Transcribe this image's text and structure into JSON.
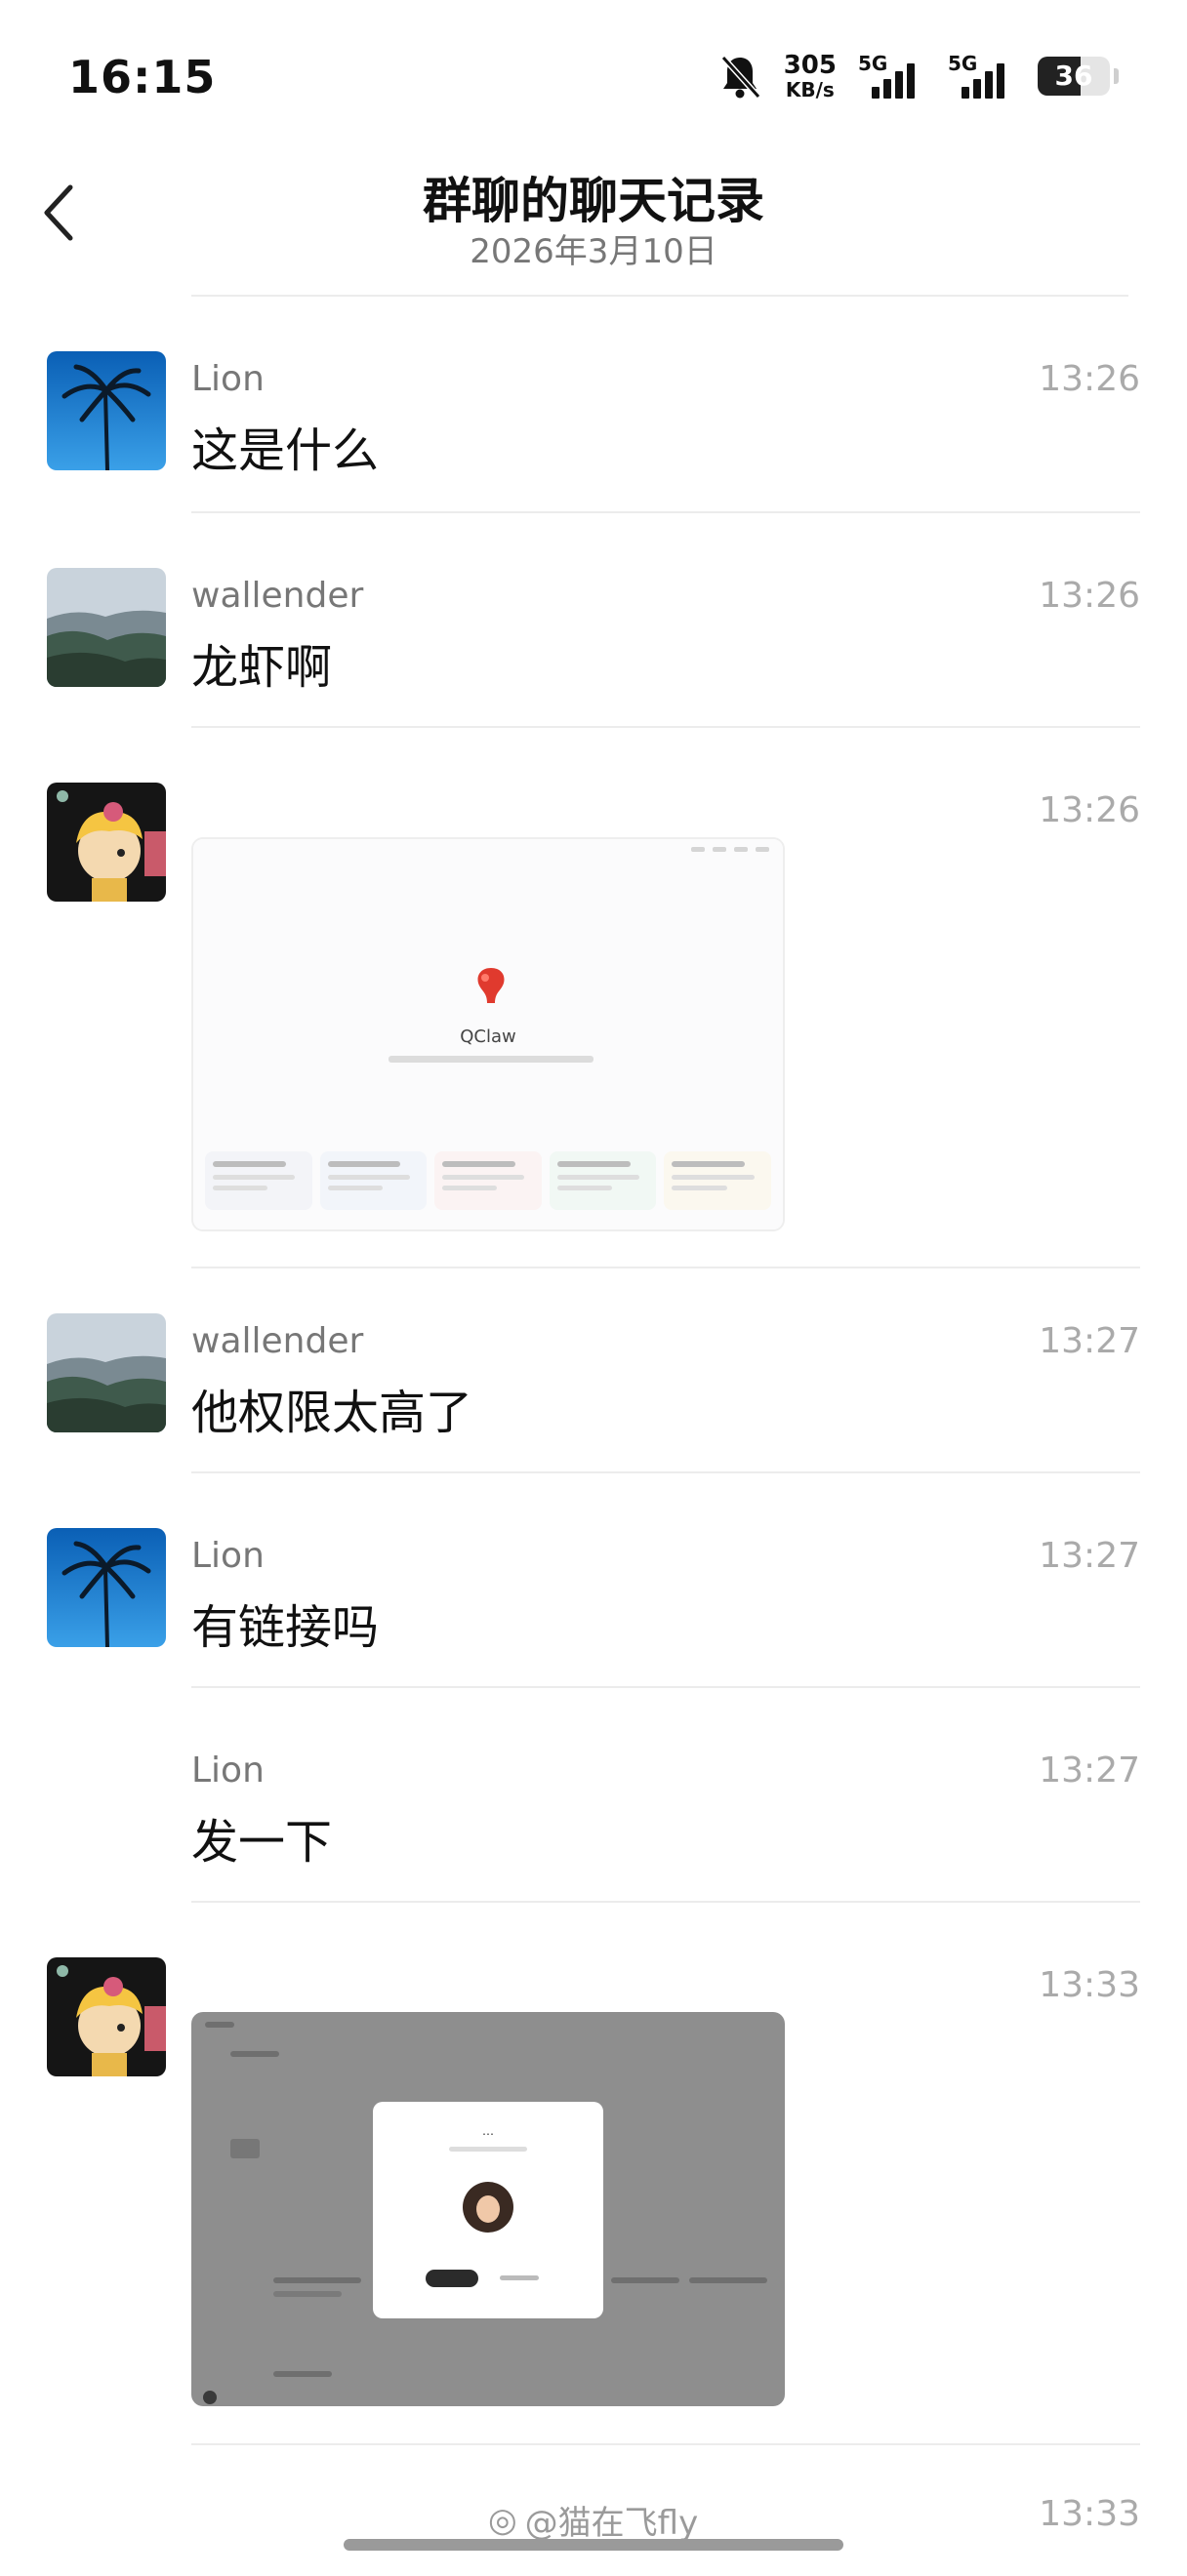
{
  "status_bar": {
    "time": "16:15",
    "net_speed_value": "305",
    "net_speed_unit": "KB/s",
    "signal1_label": "5G",
    "signal2_label": "5G",
    "battery_level": "36"
  },
  "header": {
    "title": "群聊的聊天记录",
    "date": "2026年3月10日"
  },
  "messages": [
    {
      "sender": "Lion",
      "time": "13:26",
      "text": "这是什么",
      "avatar": "palm-tree"
    },
    {
      "sender": "wallender",
      "time": "13:26",
      "text": "龙虾啊",
      "avatar": "mountain"
    },
    {
      "sender": "",
      "time": "13:26",
      "type": "image",
      "image_caption": "QClaw",
      "avatar": "cartoon-boy"
    },
    {
      "sender": "wallender",
      "time": "13:27",
      "text": "他权限太高了",
      "avatar": "mountain"
    },
    {
      "sender": "Lion",
      "time": "13:27",
      "text": "有链接吗",
      "avatar": "palm-tree"
    },
    {
      "sender": "Lion",
      "time": "13:27",
      "text": "发一下",
      "avatar": ""
    },
    {
      "sender": "",
      "time": "13:33",
      "type": "image",
      "avatar": "cartoon-boy"
    },
    {
      "sender": "",
      "time": "13:33"
    }
  ],
  "watermark": "@猫在飞fly"
}
